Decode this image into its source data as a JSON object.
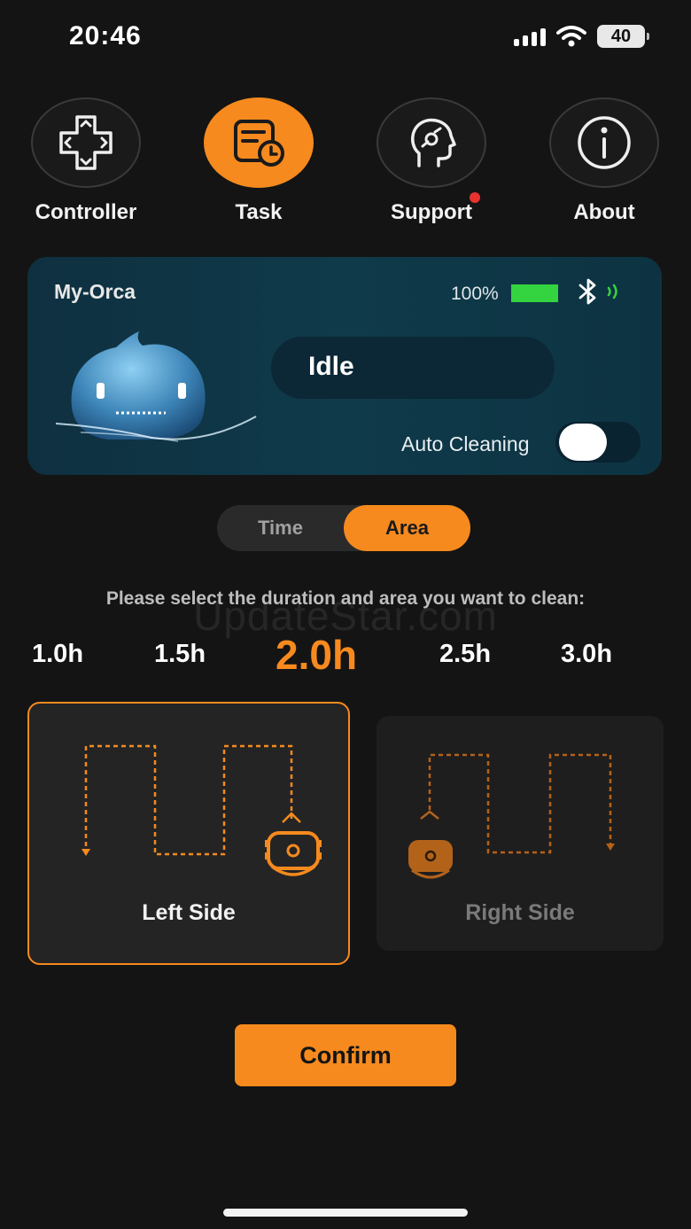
{
  "status_bar": {
    "time": "20:46",
    "battery": "40"
  },
  "nav": {
    "items": [
      {
        "label": "Controller",
        "icon": "dpad-icon"
      },
      {
        "label": "Task",
        "icon": "task-clock-icon"
      },
      {
        "label": "Support",
        "icon": "head-support-icon"
      },
      {
        "label": "About",
        "icon": "info-icon"
      }
    ],
    "active": "Task"
  },
  "device": {
    "name": "My-Orca",
    "battery_percent": "100%",
    "status": "Idle",
    "auto_cleaning_label": "Auto Cleaning",
    "auto_cleaning_on": true
  },
  "mode": {
    "options": [
      "Time",
      "Area"
    ],
    "selected": "Area"
  },
  "prompt": "Please select the duration and area you want to clean:",
  "watermark": "UpdateStar.com",
  "durations": {
    "options": [
      "1.0h",
      "1.5h",
      "2.0h",
      "2.5h",
      "3.0h"
    ],
    "selected": "2.0h"
  },
  "areas": {
    "left": "Left Side",
    "right": "Right Side",
    "selected": "Left Side"
  },
  "confirm_label": "Confirm",
  "colors": {
    "accent": "#f68a1e",
    "card": "#0f3a4a",
    "battery_green": "#34d440",
    "alert_dot": "#e8322f"
  }
}
